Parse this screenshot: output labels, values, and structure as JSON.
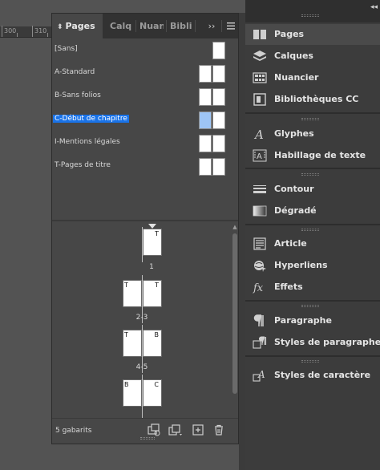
{
  "ruler": {
    "labels": [
      "300",
      "310"
    ]
  },
  "pages_panel": {
    "tabs": [
      {
        "label": "Pages"
      },
      {
        "label": "Calques"
      },
      {
        "label": "Nuancier"
      },
      {
        "label": "Bibliothèques CC"
      }
    ],
    "tab_overflow": "››",
    "masters": [
      {
        "label": "[Sans]",
        "pages": 1,
        "selected": false
      },
      {
        "label": "A-Standard",
        "pages": 2,
        "selected": false
      },
      {
        "label": "B-Sans folios",
        "pages": 2,
        "selected": false
      },
      {
        "label": "C-Début de chapitre",
        "pages": 2,
        "selected": true
      },
      {
        "label": "I-Mentions légales",
        "pages": 2,
        "selected": false
      },
      {
        "label": "T-Pages de titre",
        "pages": 2,
        "selected": false
      }
    ],
    "spreads": [
      {
        "number": "1",
        "left_letter": "",
        "right_letter": "T"
      },
      {
        "number": "2-3",
        "left_letter": "T",
        "right_letter": "T"
      },
      {
        "number": "4-5",
        "left_letter": "T",
        "right_letter": "B"
      },
      {
        "number": "",
        "left_letter": "B",
        "right_letter": "C"
      }
    ],
    "footer_text": "5 gabarits"
  },
  "dock": {
    "groups": [
      [
        {
          "label": "Pages",
          "icon": "pages-icon",
          "active": true
        },
        {
          "label": "Calques",
          "icon": "layers-icon",
          "active": false
        },
        {
          "label": "Nuancier",
          "icon": "swatches-icon",
          "active": false
        },
        {
          "label": "Bibliothèques CC",
          "icon": "cc-libraries-icon",
          "active": false
        }
      ],
      [
        {
          "label": "Glyphes",
          "icon": "glyphs-icon",
          "active": false
        },
        {
          "label": "Habillage de texte",
          "icon": "text-wrap-icon",
          "active": false
        }
      ],
      [
        {
          "label": "Contour",
          "icon": "stroke-icon",
          "active": false
        },
        {
          "label": "Dégradé",
          "icon": "gradient-icon",
          "active": false
        }
      ],
      [
        {
          "label": "Article",
          "icon": "article-icon",
          "active": false
        },
        {
          "label": "Hyperliens",
          "icon": "hyperlinks-icon",
          "active": false
        },
        {
          "label": "Effets",
          "icon": "effects-icon",
          "active": false
        }
      ],
      [
        {
          "label": "Paragraphe",
          "icon": "paragraph-icon",
          "active": false
        },
        {
          "label": "Styles de paragraphe",
          "icon": "paragraph-styles-icon",
          "active": false
        }
      ],
      [
        {
          "label": "Styles de caractère",
          "icon": "character-styles-icon",
          "active": false
        }
      ]
    ]
  },
  "colors": {
    "selection": "#1a73e8",
    "panel_bg": "#474747",
    "dock_bg": "#3c3c3c"
  }
}
